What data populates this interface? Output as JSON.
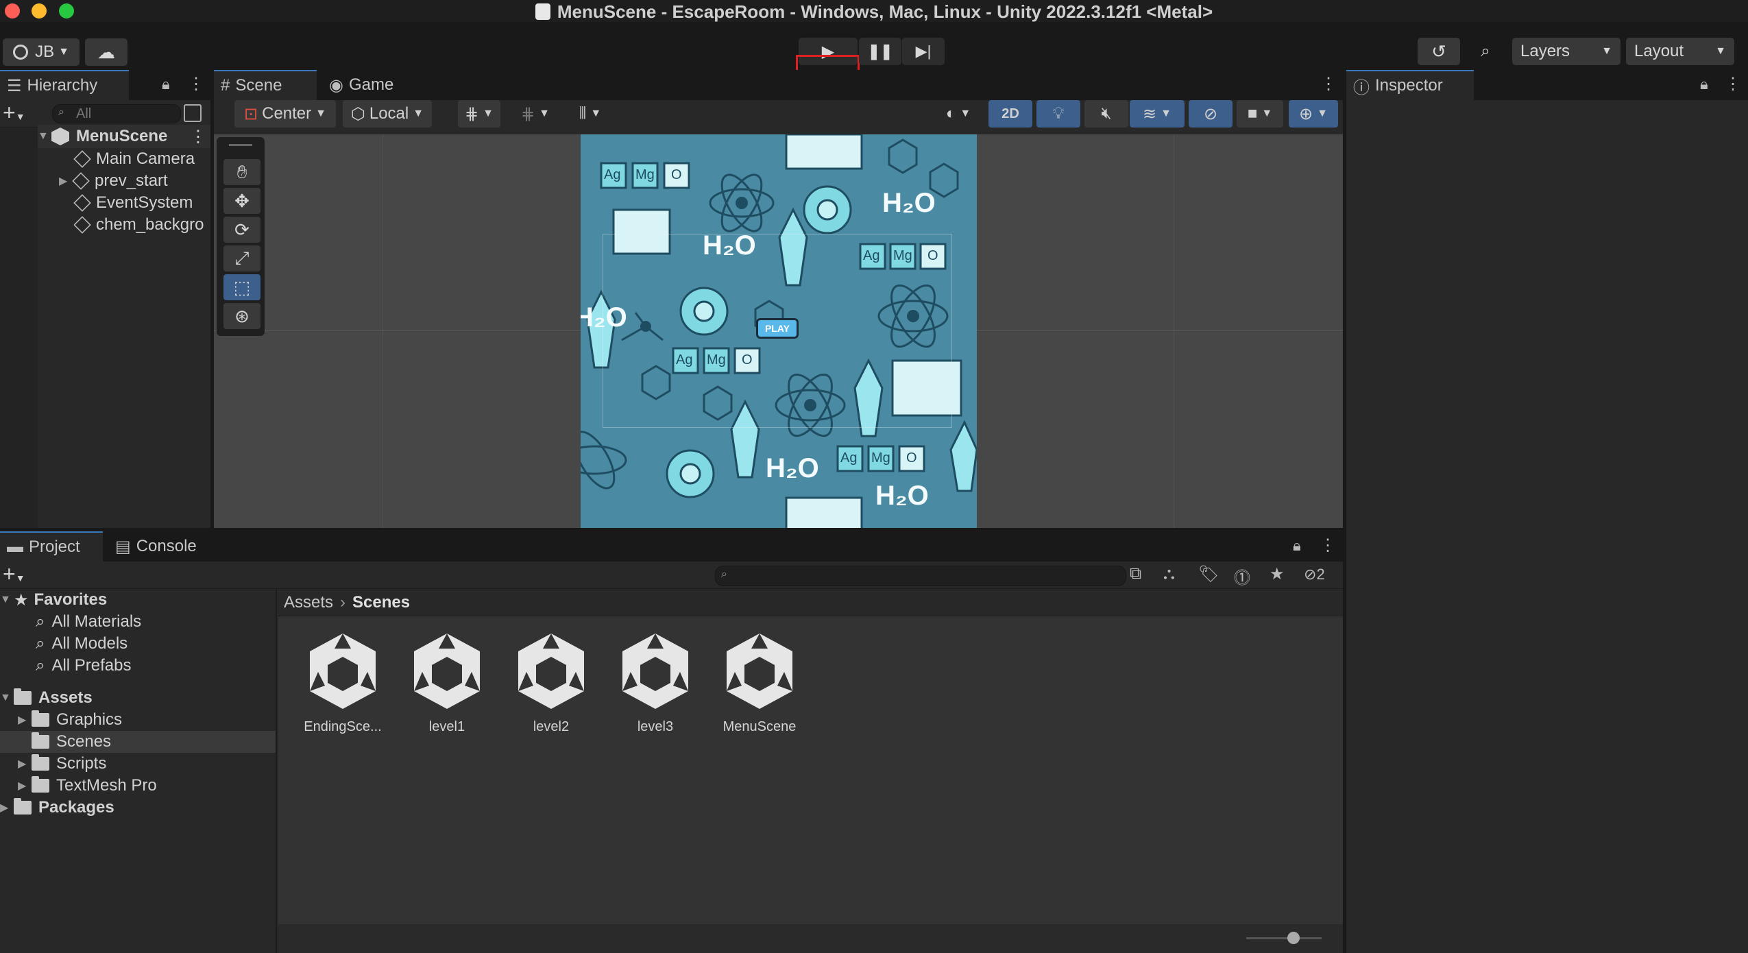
{
  "window": {
    "title": "MenuScene - EscapeRoom - Windows, Mac, Linux - Unity 2022.3.12f1 <Metal>"
  },
  "toolbar": {
    "account_label": "JB",
    "layers_label": "Layers",
    "layout_label": "Layout"
  },
  "hierarchy": {
    "tab_label": "Hierarchy",
    "search_placeholder": "All",
    "scene_name": "MenuScene",
    "items": [
      {
        "label": "Main Camera"
      },
      {
        "label": "prev_start"
      },
      {
        "label": "EventSystem"
      },
      {
        "label": "chem_backgro"
      }
    ]
  },
  "scene_view": {
    "tabs": [
      {
        "label": "Scene"
      },
      {
        "label": "Game"
      }
    ],
    "pivot_label": "Center",
    "space_label": "Local",
    "mode_2d_label": "2D",
    "canvas_texts": {
      "h2o": "H₂O",
      "ag": "Ag",
      "mg": "Mg",
      "o": "O",
      "play_button": "PLAY"
    }
  },
  "inspector": {
    "tab_label": "Inspector"
  },
  "project": {
    "tabs": [
      {
        "label": "Project"
      },
      {
        "label": "Console"
      }
    ],
    "hidden_count": "2",
    "breadcrumb": [
      "Assets",
      "Scenes"
    ],
    "favorites_label": "Favorites",
    "favorites": [
      {
        "label": "All Materials"
      },
      {
        "label": "All Models"
      },
      {
        "label": "All Prefabs"
      }
    ],
    "assets_label": "Assets",
    "asset_folders": [
      {
        "label": "Graphics"
      },
      {
        "label": "Scenes"
      },
      {
        "label": "Scripts"
      },
      {
        "label": "TextMesh Pro"
      }
    ],
    "packages_label": "Packages",
    "scene_assets": [
      {
        "label": "EndingSce..."
      },
      {
        "label": "level1"
      },
      {
        "label": "level2"
      },
      {
        "label": "level3"
      },
      {
        "label": "MenuScene"
      }
    ]
  },
  "colors": {
    "accent_blue": "#3a79bb",
    "highlight_red": "#e02020",
    "canvas_bg": "#4a8aa3",
    "canvas_tile": "#7fd8e2"
  }
}
